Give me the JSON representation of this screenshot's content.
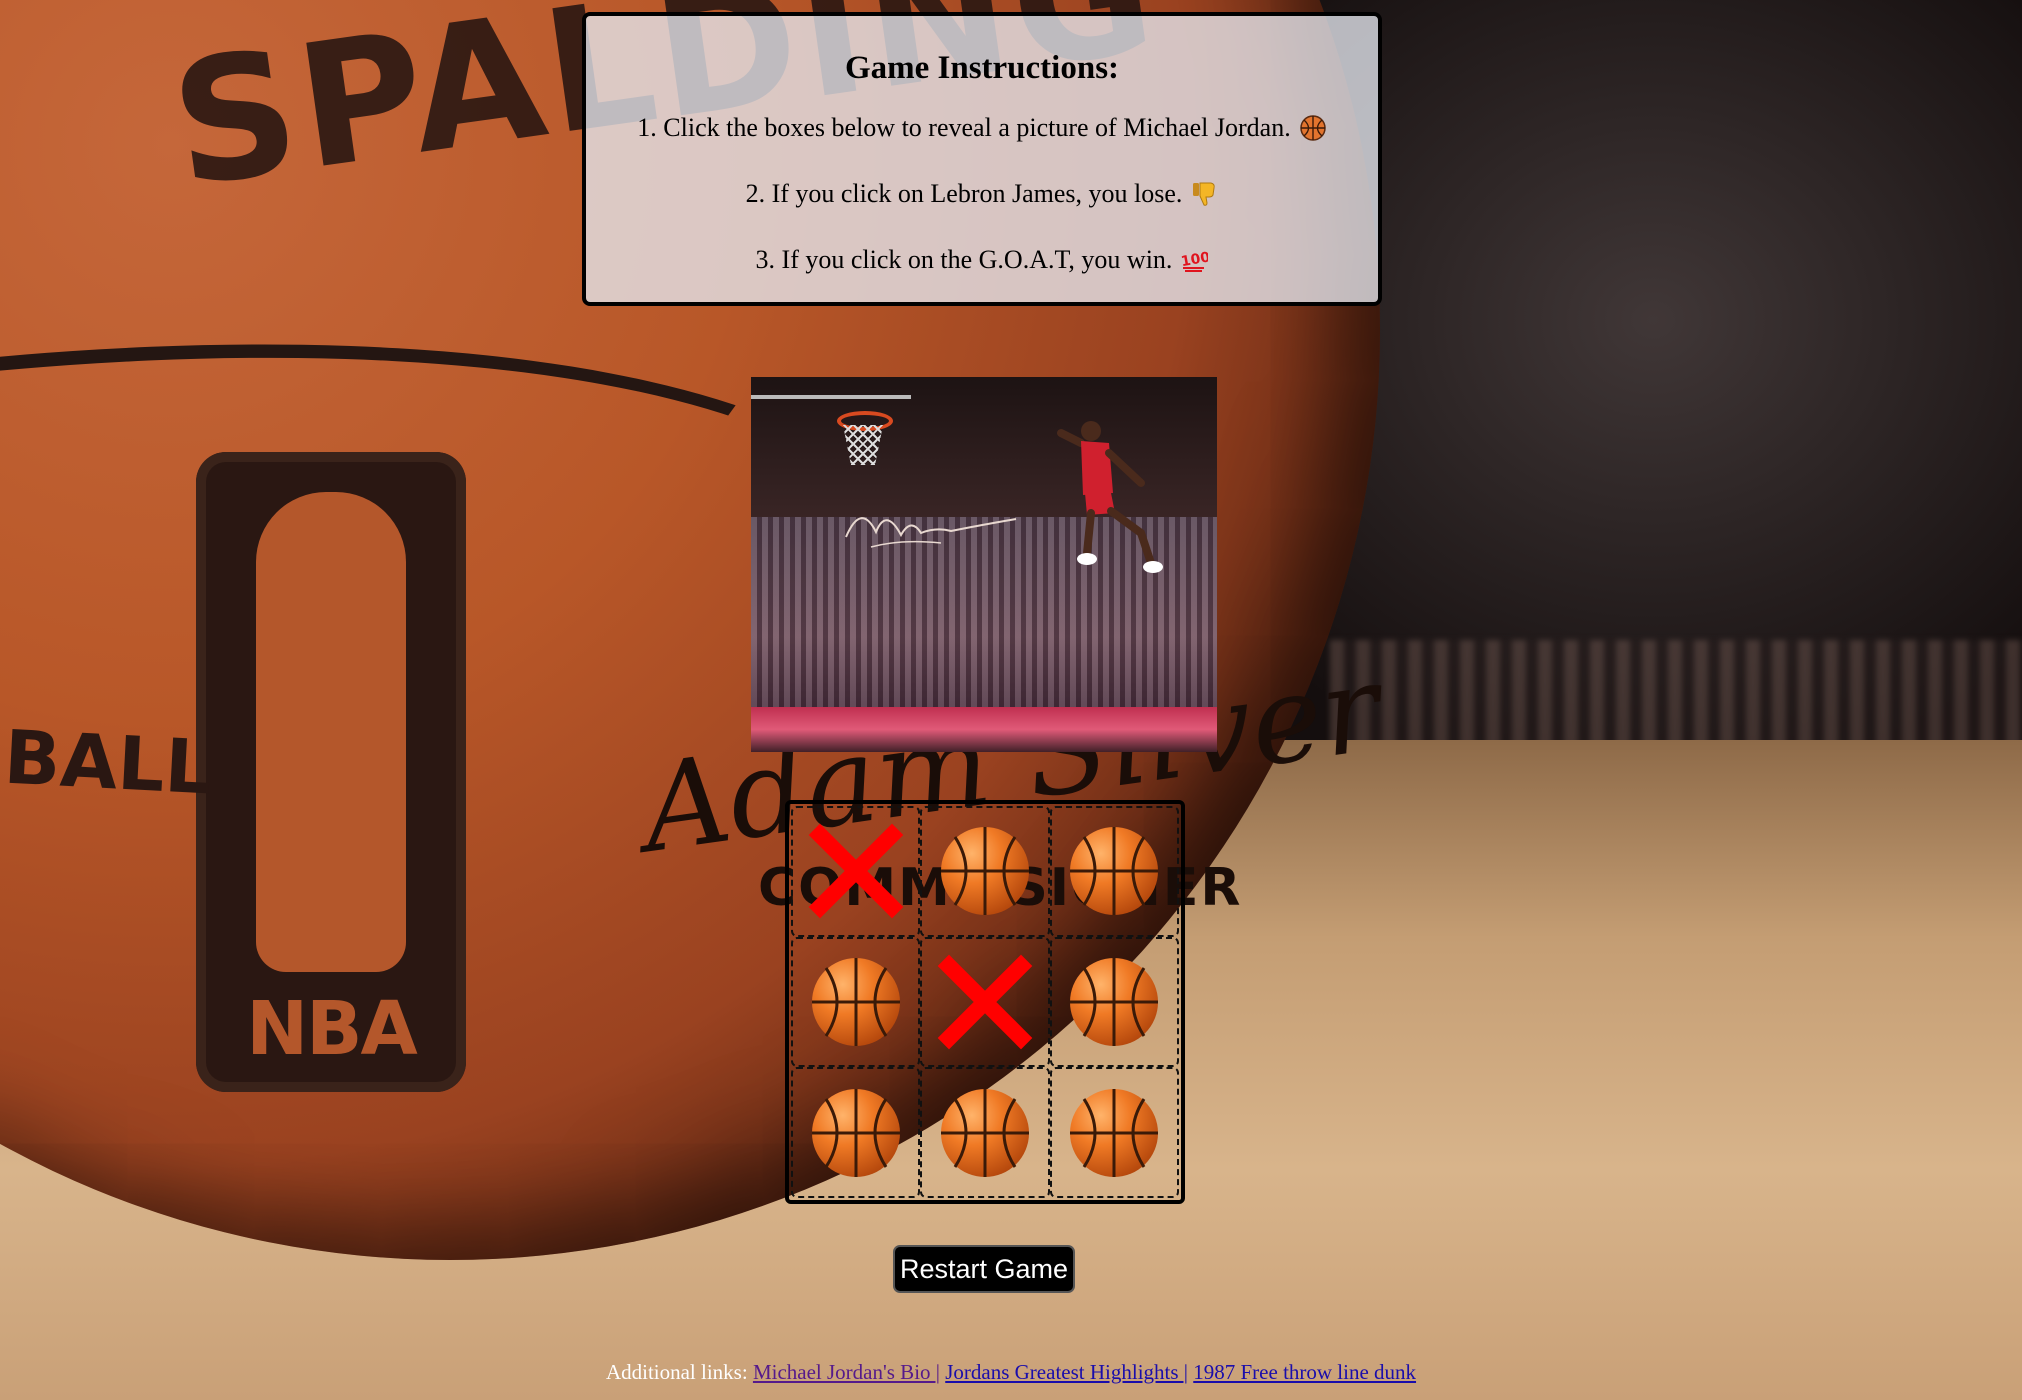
{
  "instructions": {
    "title": "Game Instructions:",
    "steps": [
      {
        "text": "1. Click the boxes below to reveal a picture of Michael Jordan.",
        "icon": "basketball-icon"
      },
      {
        "text": "2. If you click on Lebron James, you lose.",
        "icon": "thumbs-down-icon"
      },
      {
        "text": "3. If you click on the G.O.A.T, you win.",
        "icon": "hundred-points-icon"
      }
    ]
  },
  "picture": {
    "subject": "Michael Jordan dunk photo",
    "signature": "Michael Jordan"
  },
  "grid": {
    "cells": [
      "x-mark",
      "basketball",
      "basketball",
      "basketball",
      "x-mark",
      "basketball",
      "basketball",
      "basketball",
      "basketball"
    ]
  },
  "restart_button": {
    "label": "Restart Game"
  },
  "footer": {
    "prefix": "Additional links:",
    "links": [
      {
        "label": "Michael Jordan's Bio |"
      },
      {
        "label": "Jordans Greatest Highlights |"
      },
      {
        "label": "1987 Free throw line dunk"
      }
    ]
  },
  "background": {
    "ball_text_top": "SPALDING",
    "ball_text_left": "BALL",
    "ball_logo": "NBA",
    "ball_signature": "Adam Silver",
    "ball_commission": "COMMISSIONER"
  },
  "colors": {
    "x_mark": "#ff0000",
    "button_bg": "#000000",
    "link": "#1a0dab"
  }
}
